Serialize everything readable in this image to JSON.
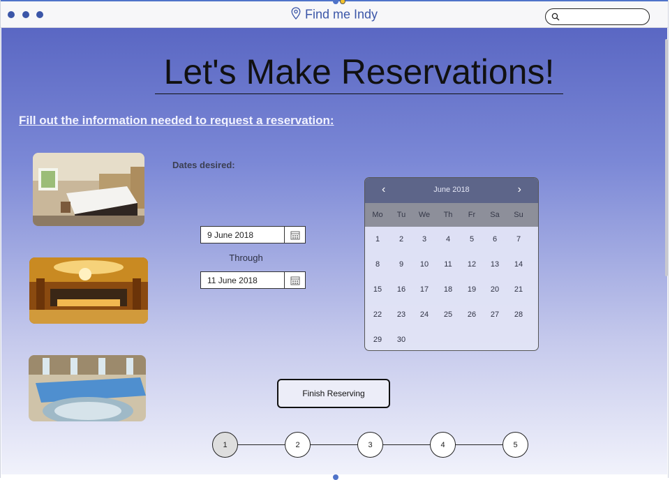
{
  "window": {
    "title": "Find me Indy",
    "search": {
      "placeholder": "",
      "value": ""
    }
  },
  "page": {
    "headline": "Let's Make Reservations!",
    "instructions": "Fill out the information needed to request a reservation:",
    "dates_label": "Dates desired:",
    "start_date": "9 June 2018",
    "through_label": "Through",
    "end_date": "11 June 2018",
    "finish_button": "Finish Reserving"
  },
  "photos": [
    {
      "name": "hotel-room-photo"
    },
    {
      "name": "hotel-lobby-photo"
    },
    {
      "name": "hotel-pool-photo"
    }
  ],
  "calendar": {
    "month_label": "June 2018",
    "prev_icon": "chevron-left-icon",
    "next_icon": "chevron-right-icon",
    "weekdays": [
      "Mo",
      "Tu",
      "We",
      "Th",
      "Fr",
      "Sa",
      "Su"
    ],
    "weeks": [
      [
        "1",
        "2",
        "3",
        "4",
        "5",
        "6",
        "7"
      ],
      [
        "8",
        "9",
        "10",
        "11",
        "12",
        "13",
        "14"
      ],
      [
        "15",
        "16",
        "17",
        "18",
        "19",
        "20",
        "21"
      ],
      [
        "22",
        "23",
        "24",
        "25",
        "26",
        "27",
        "28"
      ],
      [
        "29",
        "30"
      ]
    ]
  },
  "steps": {
    "labels": [
      "1",
      "2",
      "3",
      "4",
      "5"
    ],
    "current": "1"
  },
  "colors": {
    "accent": "#3b56a8",
    "gradient_top": "#5a67c3",
    "gradient_bottom": "#f1f2fb",
    "calendar_header": "#5d6589"
  }
}
